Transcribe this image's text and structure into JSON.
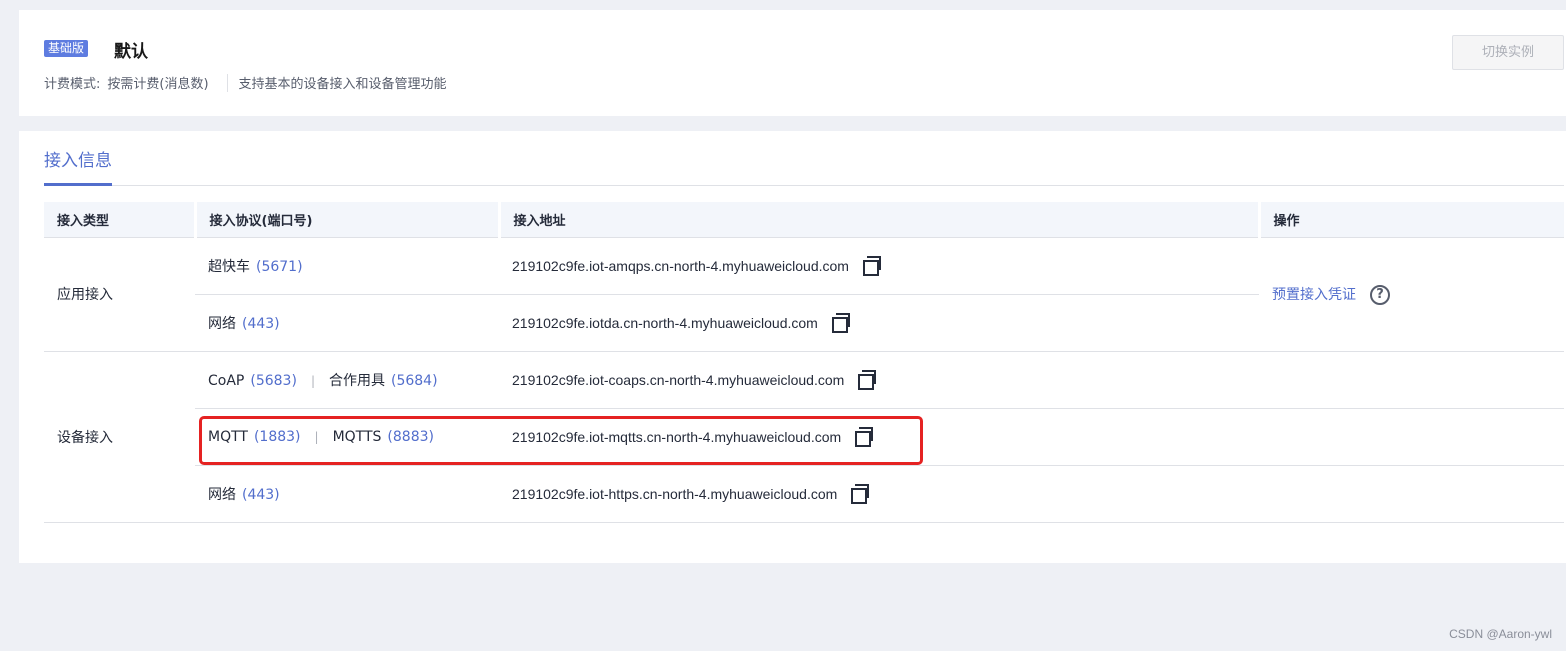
{
  "instance": {
    "badge": "基础版",
    "name": "默认",
    "billing_label": "计费模式:",
    "billing_value": "按需计费(消息数)",
    "description": "支持基本的设备接入和设备管理功能",
    "switch_button": "切换实例"
  },
  "tab": {
    "label": "接入信息"
  },
  "table": {
    "headers": [
      "接入类型",
      "接入协议(端口号)",
      "接入地址",
      "操作"
    ],
    "app_access": {
      "type": "应用接入",
      "rows": [
        {
          "protocol": "超快车",
          "port": "(5671)",
          "address": "219102c9fe.iot-amqps.cn-north-4.myhuaweicloud.com"
        },
        {
          "protocol": "网络",
          "port": "(443)",
          "address": "219102c9fe.iotda.cn-north-4.myhuaweicloud.com"
        }
      ],
      "action": "预置接入凭证",
      "help": "?"
    },
    "device_access": {
      "type": "设备接入",
      "rows": [
        {
          "protocol": "CoAP",
          "port": "(5683)",
          "protocol2": "合作用具",
          "port2": "(5684)",
          "address": "219102c9fe.iot-coaps.cn-north-4.myhuaweicloud.com"
        },
        {
          "protocol": "MQTT",
          "port": "(1883)",
          "protocol2": "MQTTS",
          "port2": "(8883)",
          "address": "219102c9fe.iot-mqtts.cn-north-4.myhuaweicloud.com"
        },
        {
          "protocol": "网络",
          "port": "(443)",
          "address": "219102c9fe.iot-https.cn-north-4.myhuaweicloud.com"
        }
      ]
    },
    "separator": "|"
  },
  "watermark": "CSDN @Aaron-ywl",
  "colors": {
    "accent": "#526ecc",
    "highlight": "#e52222",
    "background": "#eef0f5"
  }
}
